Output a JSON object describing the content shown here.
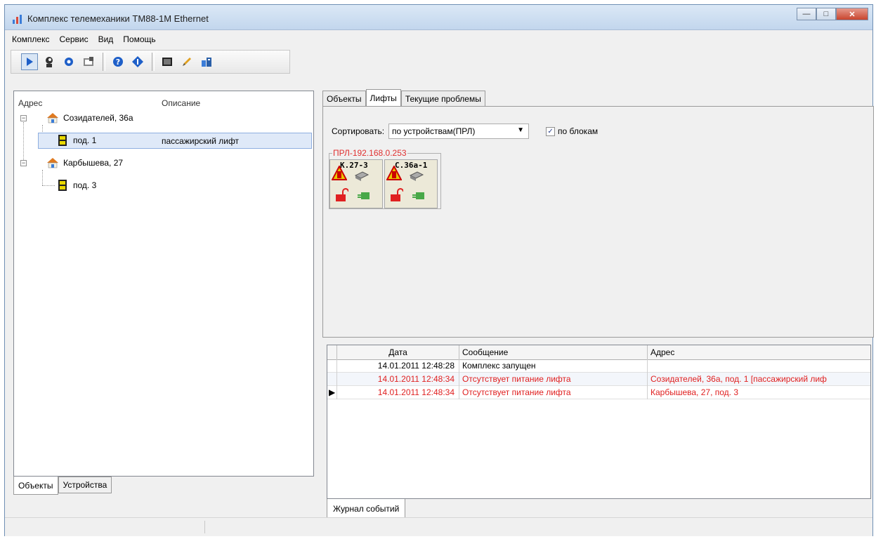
{
  "window": {
    "title": "Комплекс телемеханики ТМ88-1М Ethernet"
  },
  "menu": [
    "Комплекс",
    "Сервис",
    "Вид",
    "Помощь"
  ],
  "tree": {
    "col_address": "Адрес",
    "col_description": "Описание",
    "nodes": [
      {
        "label": "Созидателей, 36а"
      },
      {
        "label": "под. 1",
        "description": "пассажирский лифт"
      },
      {
        "label": "Карбышева, 27"
      },
      {
        "label": "под. 3"
      }
    ]
  },
  "left_tabs": [
    "Объекты",
    "Устройства"
  ],
  "right_tabs": [
    "Объекты",
    "Лифты",
    "Текущие проблемы"
  ],
  "sort": {
    "label": "Сортировать:",
    "value": "по устройствам(ПРЛ)",
    "by_blocks_label": "по блокам",
    "by_blocks_checked": true
  },
  "group": {
    "title": "ПРЛ-192.168.0.253",
    "lifts": [
      "К.27-3",
      "С.36а-1"
    ]
  },
  "log": {
    "columns": [
      "Дата",
      "Сообщение",
      "Адрес"
    ],
    "rows": [
      {
        "date": "14.01.2011 12:48:28",
        "message": "Комплекс запущен",
        "address": "",
        "alert": false,
        "current": false
      },
      {
        "date": "14.01.2011 12:48:34",
        "message": "Отсутствует питание лифта",
        "address": "Созидателей, 36а, под. 1 [пассажирский лиф",
        "alert": true,
        "current": false
      },
      {
        "date": "14.01.2011 12:48:34",
        "message": "Отсутствует питание лифта",
        "address": "Карбышева, 27, под. 3",
        "alert": true,
        "current": true
      }
    ]
  },
  "bottom_tab": "Журнал событий",
  "colors": {
    "alert": "#e02020",
    "title_gradient_top": "#dbe8f6",
    "selection": "#dfe9f8"
  }
}
